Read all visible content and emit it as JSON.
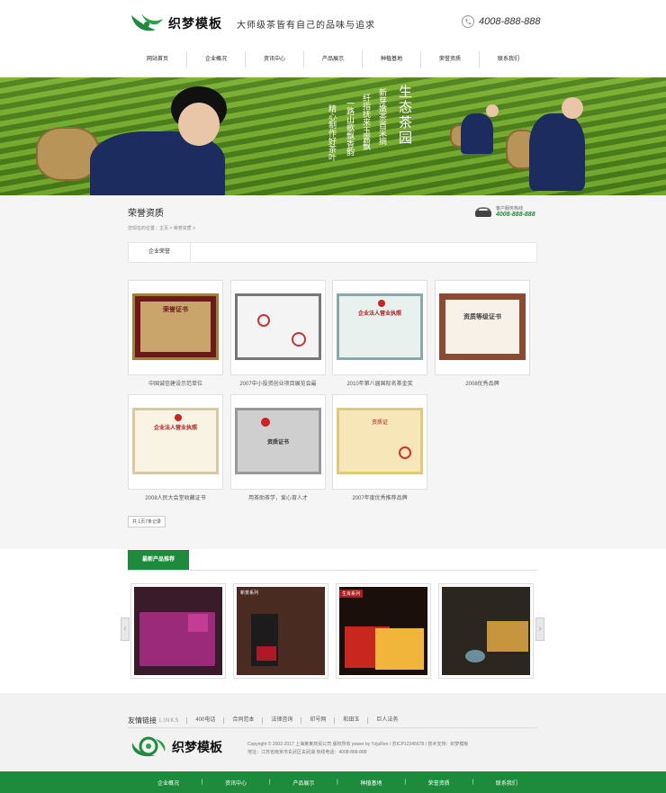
{
  "header": {
    "logo_text": "织梦模板",
    "slogan": "大师级茶皆有自己的品味与追求",
    "phone": "4008-888-888"
  },
  "nav": [
    "网站首页",
    "企业概况",
    "资讯中心",
    "产品展示",
    "种植基地",
    "荣誉资质",
    "联系我们"
  ],
  "banner": {
    "poem": [
      "生态茶园",
      "新芽嫩茶首采摘",
      "纤指抚来玉露飘",
      "一路山歌飘香韵",
      "精心制作好茶叶"
    ]
  },
  "section": {
    "title": "荣誉资质",
    "hotline_label": "客户服务热线",
    "hotline": "4008-888-888",
    "breadcrumb": "您现在的位置：主页 > 荣誉资质 >",
    "tab": "企业荣誉"
  },
  "certs": [
    {
      "caption": "中国诚信建设示范单位"
    },
    {
      "caption": "2007中小投资创业项目展览会最"
    },
    {
      "caption": "2010年第八届国际名茶金奖"
    },
    {
      "caption": "2008优秀品牌"
    },
    {
      "caption": "2008人民大会堂收藏证书"
    },
    {
      "caption": "用茶助茶学，爱心育人才"
    },
    {
      "caption": "2007年度优秀推荐品牌"
    }
  ],
  "cert_texts": [
    "荣誉证书",
    "",
    "企业法人营业执照",
    "资质等级证书",
    "企业法人营业执照",
    "资质证书",
    "资质证"
  ],
  "pager": "共 1页7条记录",
  "products": {
    "heading": "最新产品推荐",
    "labels": [
      "",
      "新茶系列",
      "生肖系列",
      ""
    ]
  },
  "footer": {
    "links_title": "友情链接",
    "links_en": "LINKS",
    "links": [
      "400电话",
      "合同范本",
      "法律咨询",
      "印号网",
      "和田玉",
      "巨人法务"
    ],
    "logo_text": "织梦模板",
    "copyright": "Copyright © 2002-2017 上海某某商贸公司 版权所有 power by YzjuRen / 苏ICP12345678 / 技术支持：织梦模板",
    "address": "地址：江苏省南京市玄武区玄武湖 热线电话：4008-888-888",
    "bottom_nav": [
      "企业概况",
      "资讯中心",
      "产品展示",
      "种植基地",
      "荣誉资质",
      "联系我们"
    ]
  },
  "colors": {
    "brand_green": "#1e8a3c",
    "hotline_green": "#1f8a3a"
  }
}
